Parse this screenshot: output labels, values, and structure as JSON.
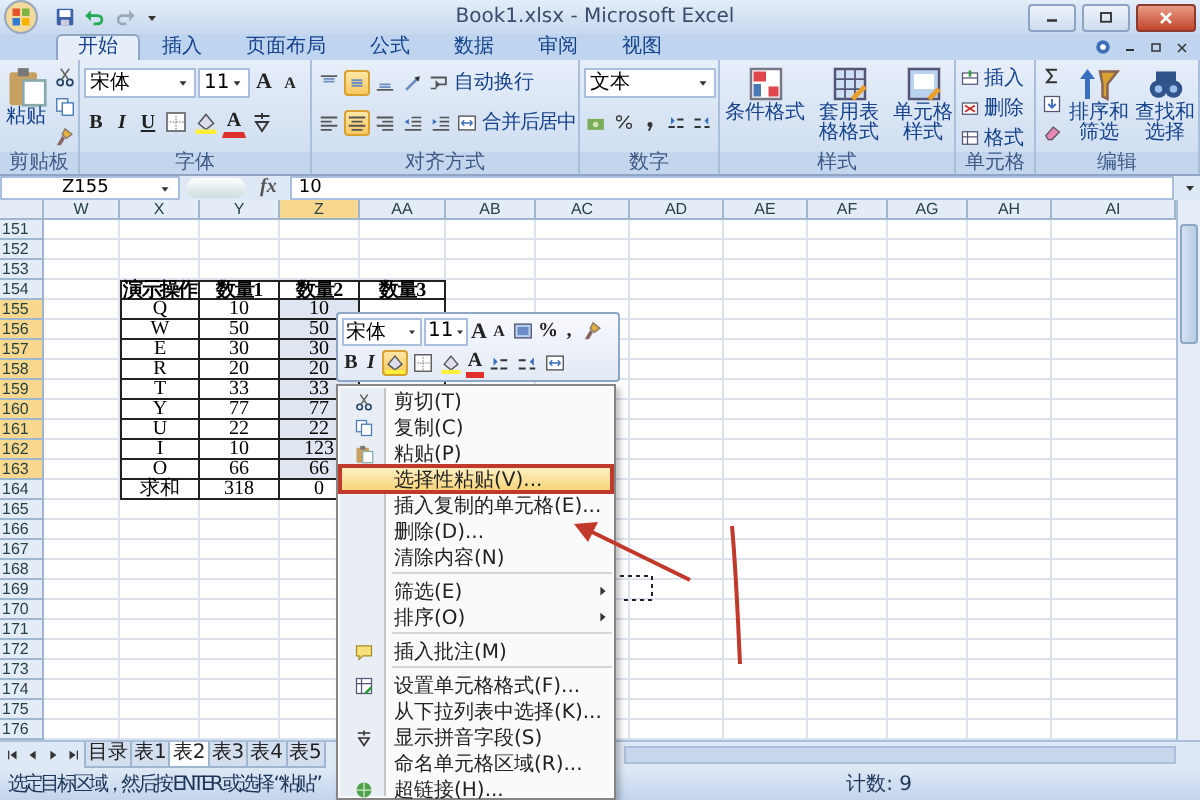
{
  "window": {
    "title": "Book1.xlsx - Microsoft Excel"
  },
  "tabs": [
    {
      "label": "开始",
      "selected": true
    },
    {
      "label": "插入",
      "selected": false
    },
    {
      "label": "页面布局",
      "selected": false
    },
    {
      "label": "公式",
      "selected": false
    },
    {
      "label": "数据",
      "selected": false
    },
    {
      "label": "审阅",
      "selected": false
    },
    {
      "label": "视图",
      "selected": false
    }
  ],
  "ribbon": {
    "groups": [
      {
        "kind": "clipboard",
        "label": "剪贴板",
        "paste": "粘贴"
      },
      {
        "kind": "font",
        "label": "字体",
        "font": "宋体",
        "size": "11",
        "grow": "A",
        "shrink": "A",
        "styles": [
          "B",
          "I",
          "U"
        ],
        "color_letter": "A"
      },
      {
        "kind": "alignment",
        "label": "对齐方式",
        "wrap": "自动换行",
        "merge": "合并后居中",
        "middle_align_on": true,
        "center_align_on": true
      },
      {
        "kind": "number",
        "label": "数字",
        "format": "文本"
      },
      {
        "kind": "styles",
        "label": "样式",
        "buttons": [
          "条件格式",
          "套用表格格式",
          "单元格样式"
        ]
      },
      {
        "kind": "cells",
        "label": "单元格",
        "buttons": [
          "插入",
          "删除",
          "格式"
        ]
      },
      {
        "kind": "editing",
        "label": "编辑",
        "buttons": [
          "排序和筛选",
          "查找和选择"
        ]
      }
    ]
  },
  "formula_bar": {
    "name_box": "Z155",
    "function_label": "fx",
    "value": "10"
  },
  "sheet": {
    "columns": [
      {
        "label": "W",
        "selected": false
      },
      {
        "label": "X",
        "selected": false
      },
      {
        "label": "Y",
        "selected": false
      },
      {
        "label": "Z",
        "selected": true
      },
      {
        "label": "AA",
        "selected": false
      },
      {
        "label": "AB",
        "selected": false
      },
      {
        "label": "AC",
        "selected": false
      },
      {
        "label": "AD",
        "selected": false
      },
      {
        "label": "AE",
        "selected": false
      },
      {
        "label": "AF",
        "selected": false
      },
      {
        "label": "AG",
        "selected": false
      },
      {
        "label": "AH",
        "selected": false
      },
      {
        "label": "AI",
        "selected": false
      }
    ],
    "rows": [
      {
        "label": "151",
        "selected": false
      },
      {
        "label": "152",
        "selected": false
      },
      {
        "label": "153",
        "selected": false
      },
      {
        "label": "154",
        "selected": false
      },
      {
        "label": "155",
        "selected": true
      },
      {
        "label": "156",
        "selected": true
      },
      {
        "label": "157",
        "selected": true
      },
      {
        "label": "158",
        "selected": true
      },
      {
        "label": "159",
        "selected": true
      },
      {
        "label": "160",
        "selected": true
      },
      {
        "label": "161",
        "selected": true
      },
      {
        "label": "162",
        "selected": true
      },
      {
        "label": "163",
        "selected": true
      },
      {
        "label": "164",
        "selected": false
      },
      {
        "label": "165",
        "selected": false
      },
      {
        "label": "166",
        "selected": false
      },
      {
        "label": "167",
        "selected": false
      },
      {
        "label": "168",
        "selected": false
      },
      {
        "label": "169",
        "selected": false
      },
      {
        "label": "170",
        "selected": false
      },
      {
        "label": "171",
        "selected": false
      },
      {
        "label": "172",
        "selected": false
      },
      {
        "label": "173",
        "selected": false
      },
      {
        "label": "174",
        "selected": false
      },
      {
        "label": "175",
        "selected": false
      },
      {
        "label": "176",
        "selected": false
      }
    ],
    "table": {
      "header": [
        "演示操作",
        "数量1",
        "数量2",
        "数量3"
      ],
      "rows": [
        [
          "Q",
          "10",
          "10"
        ],
        [
          "W",
          "50",
          "50"
        ],
        [
          "E",
          "30",
          "30"
        ],
        [
          "R",
          "20",
          "20"
        ],
        [
          "T",
          "33",
          "33"
        ],
        [
          "Y",
          "77",
          "77"
        ],
        [
          "U",
          "22",
          "22"
        ],
        [
          "I",
          "10",
          "123"
        ],
        [
          "O",
          "66",
          "66"
        ],
        [
          "求和",
          "318",
          "0"
        ]
      ]
    }
  },
  "mini_toolbar": {
    "font": "宋体",
    "size": "11",
    "grow": "A",
    "shrink": "A",
    "percent": "%",
    "comma": ",",
    "bold": "B",
    "italic": "I",
    "font_color": "A",
    "fill_on": true
  },
  "context_menu": {
    "items": [
      {
        "kind": "item",
        "label": "剪切(T)",
        "selected": false,
        "boxed": false,
        "submenu": false
      },
      {
        "kind": "item",
        "label": "复制(C)",
        "selected": false,
        "boxed": false,
        "submenu": false
      },
      {
        "kind": "item",
        "label": "粘贴(P)",
        "selected": false,
        "boxed": false,
        "submenu": false
      },
      {
        "kind": "item",
        "label": "选择性粘贴(V)...",
        "selected": true,
        "boxed": true,
        "submenu": false
      },
      {
        "kind": "item",
        "label": "插入复制的单元格(E)...",
        "selected": false,
        "boxed": false,
        "submenu": false
      },
      {
        "kind": "item",
        "label": "删除(D)...",
        "selected": false,
        "boxed": false,
        "submenu": false
      },
      {
        "kind": "item",
        "label": "清除内容(N)",
        "selected": false,
        "boxed": false,
        "submenu": false
      },
      {
        "kind": "separator"
      },
      {
        "kind": "item",
        "label": "筛选(E)",
        "selected": false,
        "boxed": false,
        "submenu": true
      },
      {
        "kind": "item",
        "label": "排序(O)",
        "selected": false,
        "boxed": false,
        "submenu": true
      },
      {
        "kind": "separator"
      },
      {
        "kind": "item",
        "label": "插入批注(M)",
        "selected": false,
        "boxed": false,
        "submenu": false
      },
      {
        "kind": "separator"
      },
      {
        "kind": "item",
        "label": "设置单元格格式(F)...",
        "selected": false,
        "boxed": false,
        "submenu": false
      },
      {
        "kind": "item",
        "label": "从下拉列表中选择(K)...",
        "selected": false,
        "boxed": false,
        "submenu": false
      },
      {
        "kind": "item",
        "label": "显示拼音字段(S)",
        "selected": false,
        "boxed": false,
        "submenu": false
      },
      {
        "kind": "item",
        "label": "命名单元格区域(R)...",
        "selected": false,
        "boxed": false,
        "submenu": false
      },
      {
        "kind": "item",
        "label": "超链接(H)...",
        "selected": false,
        "boxed": false,
        "submenu": false
      }
    ]
  },
  "sheet_tabs": [
    {
      "label": "目录",
      "selected": false
    },
    {
      "label": "表1",
      "selected": false
    },
    {
      "label": "表2",
      "selected": true
    },
    {
      "label": "表3",
      "selected": false
    },
    {
      "label": "表4",
      "selected": false
    },
    {
      "label": "表5",
      "selected": false
    }
  ],
  "status_bar": {
    "message": "选定目标区域，然后按 ENTER 或选择 “粘贴”",
    "count": "计数: 9"
  }
}
